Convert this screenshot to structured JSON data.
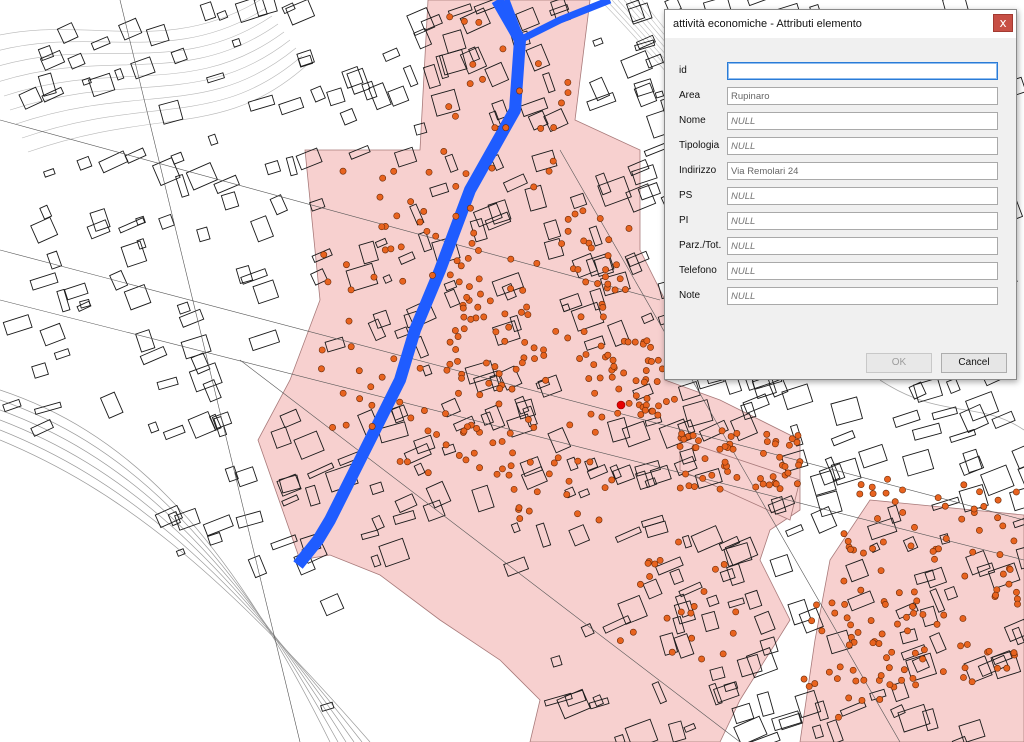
{
  "map": {
    "colors": {
      "zone_fill": "#f7d0cf",
      "zone_stroke": "#a87a7a",
      "river": "#1f5cff",
      "point_fill": "#e8631f",
      "point_stroke": "#6b2a08",
      "building_stroke": "#1a1a1a",
      "selected_point": "#e60000"
    }
  },
  "dialog": {
    "title": "attività economiche - Attributi elemento",
    "close_glyph": "x",
    "fields": [
      {
        "label": "id",
        "value": "",
        "placeholder": ""
      },
      {
        "label": "Area",
        "value": "Rupinaro",
        "placeholder": ""
      },
      {
        "label": "Nome",
        "value": "",
        "placeholder": "NULL"
      },
      {
        "label": "Tipologia",
        "value": "",
        "placeholder": "NULL"
      },
      {
        "label": "Indirizzo",
        "value": "Via Remolari 24",
        "placeholder": ""
      },
      {
        "label": "PS",
        "value": "",
        "placeholder": "NULL"
      },
      {
        "label": "PI",
        "value": "",
        "placeholder": "NULL"
      },
      {
        "label": "Parz./Tot.",
        "value": "",
        "placeholder": "NULL"
      },
      {
        "label": "Telefono",
        "value": "",
        "placeholder": "NULL"
      },
      {
        "label": "Note",
        "value": "",
        "placeholder": "NULL"
      }
    ],
    "ok_label": "OK",
    "cancel_label": "Cancel"
  }
}
